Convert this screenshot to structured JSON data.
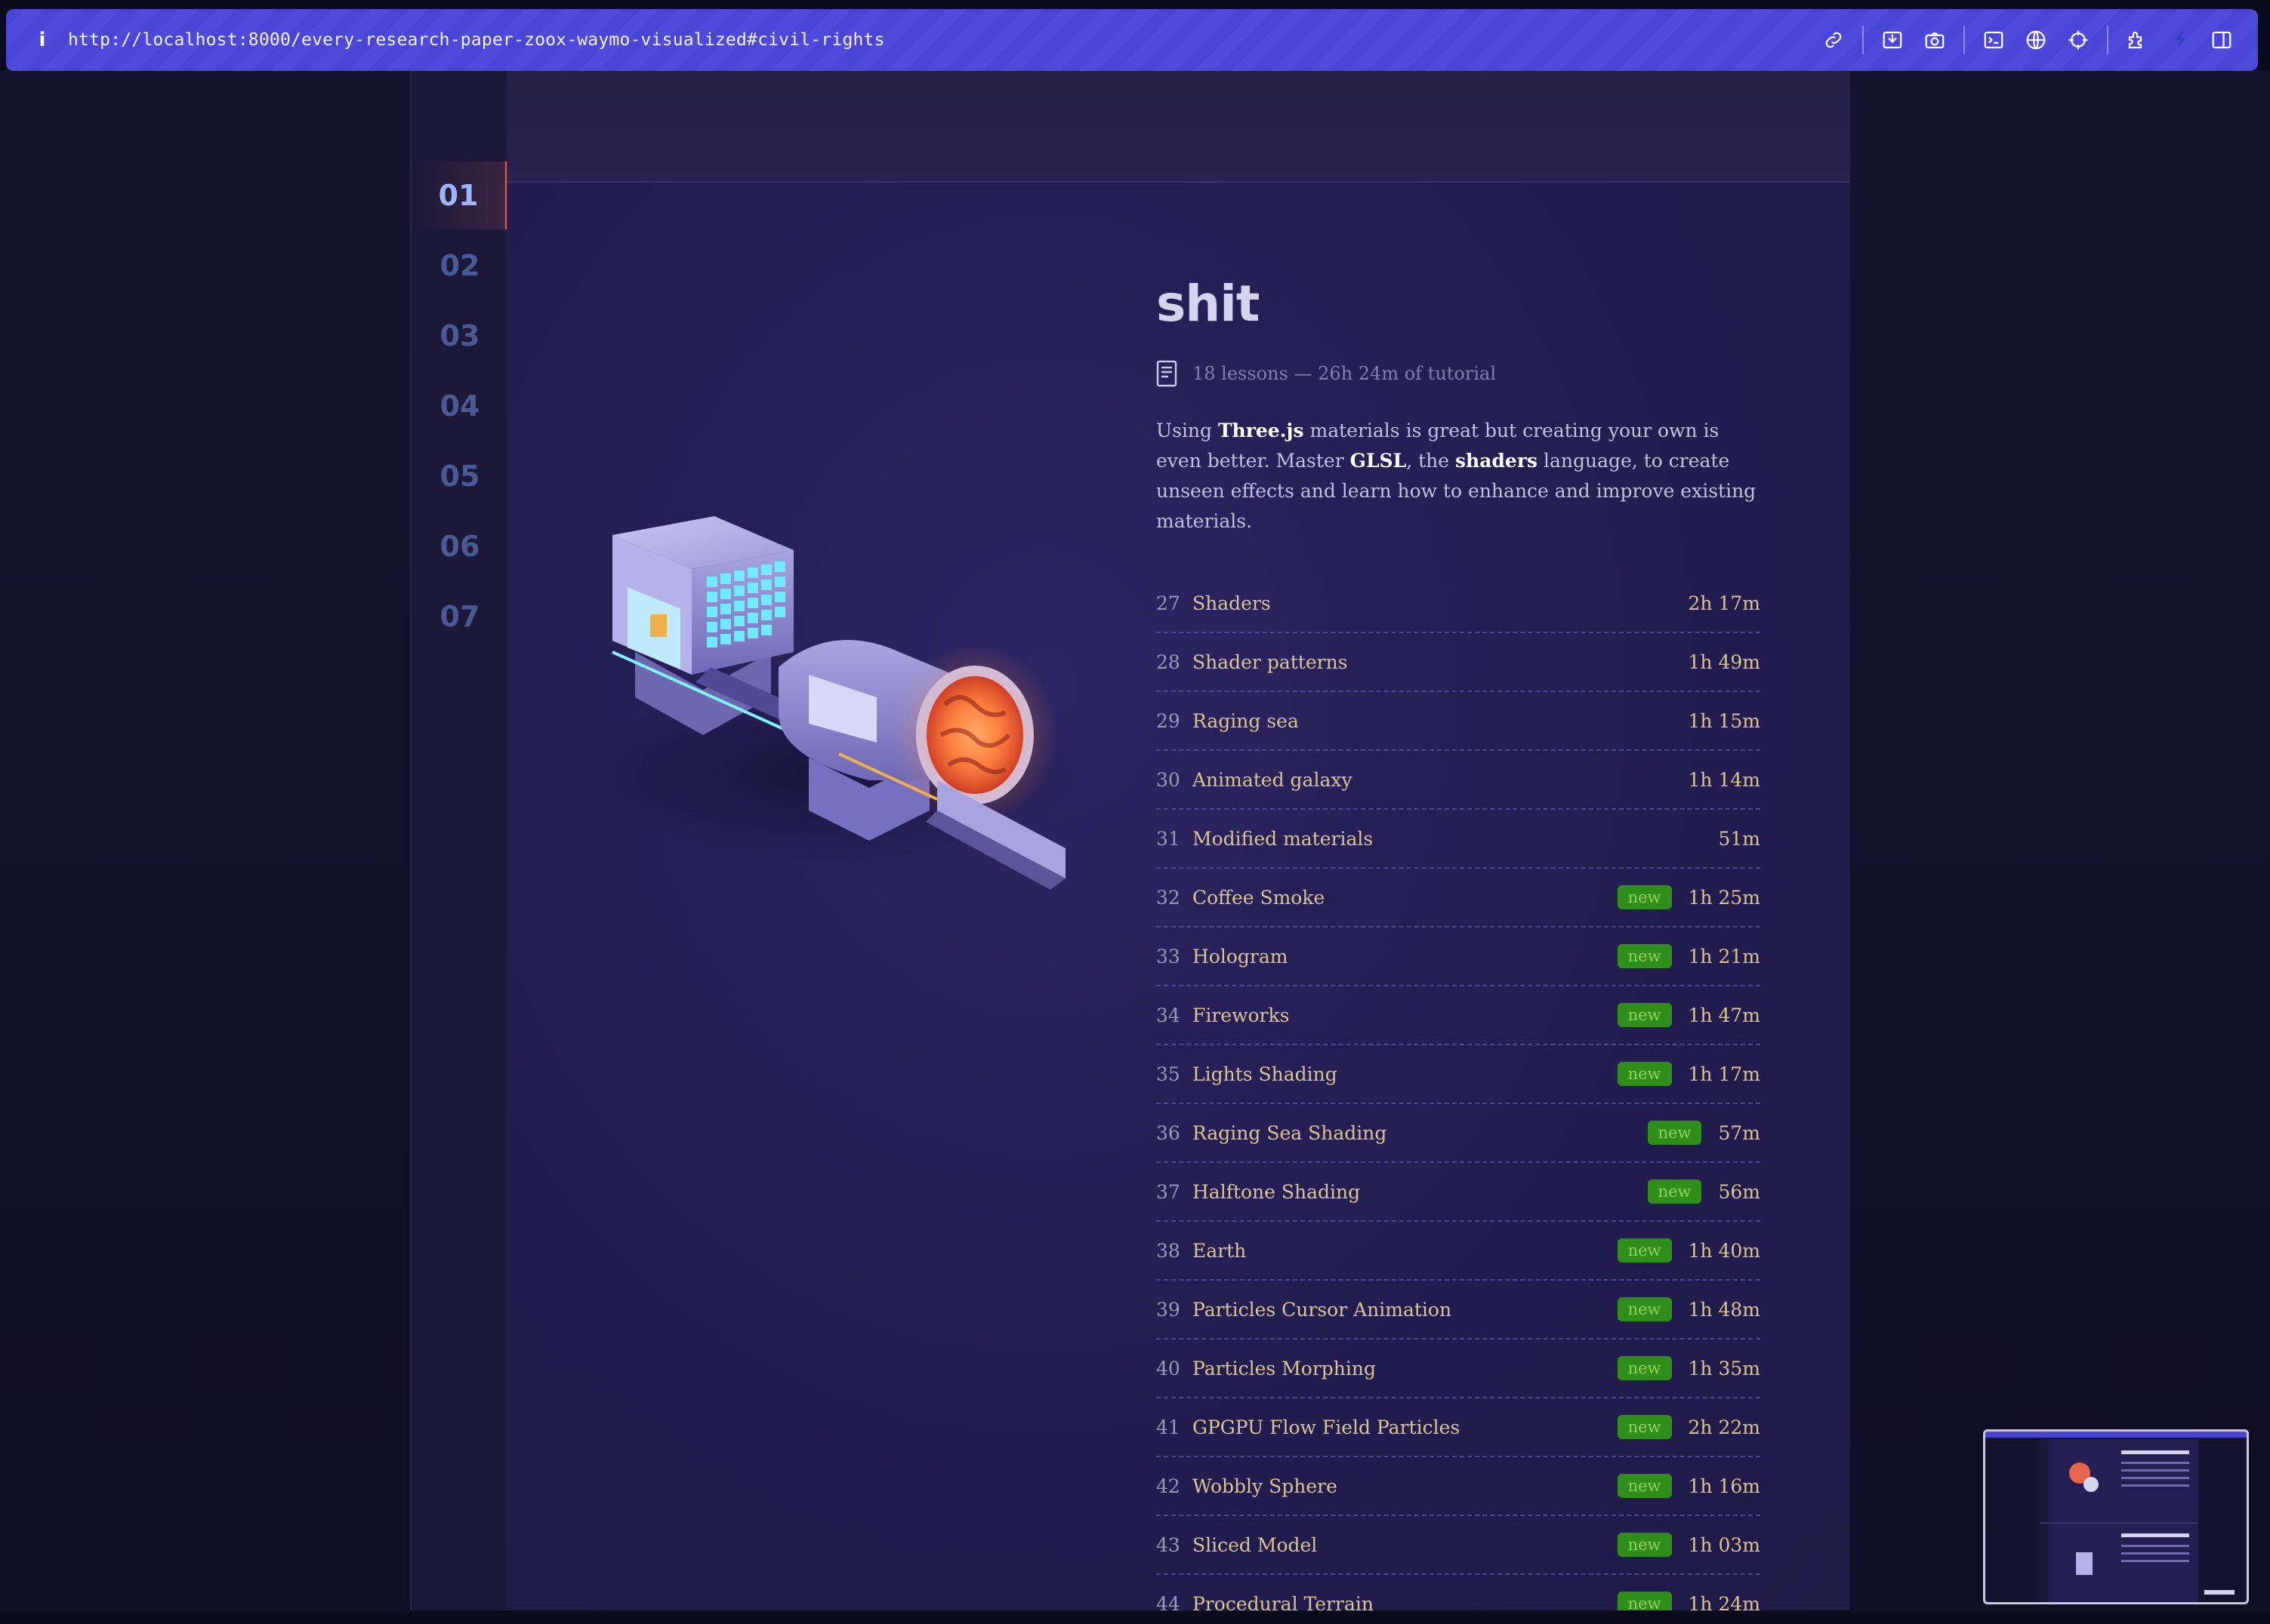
{
  "browser": {
    "url": "http://localhost:8000/every-research-paper-zoox-waymo-visualized#civil-rights",
    "info_label": "i"
  },
  "chapters": [
    {
      "label": "01",
      "active": true
    },
    {
      "label": "02",
      "active": false
    },
    {
      "label": "03",
      "active": false
    },
    {
      "label": "04",
      "active": false
    },
    {
      "label": "05",
      "active": false
    },
    {
      "label": "06",
      "active": false
    },
    {
      "label": "07",
      "active": false
    }
  ],
  "section": {
    "title": "shit",
    "meta": "18 lessons — 26h 24m of tutorial",
    "desc": {
      "p1": "Using ",
      "b1": "Three.js",
      "p2": " materials is great but creating your own is even better. Master ",
      "b2": "GLSL",
      "p3": ", the ",
      "b3": "shaders",
      "p4": " language, to create unseen effects and learn how to enhance and improve existing materials."
    }
  },
  "lessons": [
    {
      "num": "27",
      "name": "Shaders",
      "badge": "",
      "duration": "2h 17m"
    },
    {
      "num": "28",
      "name": "Shader patterns",
      "badge": "",
      "duration": "1h 49m"
    },
    {
      "num": "29",
      "name": "Raging sea",
      "badge": "",
      "duration": "1h 15m"
    },
    {
      "num": "30",
      "name": "Animated galaxy",
      "badge": "",
      "duration": "1h 14m"
    },
    {
      "num": "31",
      "name": "Modified materials",
      "badge": "",
      "duration": "51m"
    },
    {
      "num": "32",
      "name": "Coffee Smoke",
      "badge": "new",
      "duration": "1h 25m"
    },
    {
      "num": "33",
      "name": "Hologram",
      "badge": "new",
      "duration": "1h 21m"
    },
    {
      "num": "34",
      "name": "Fireworks",
      "badge": "new",
      "duration": "1h 47m"
    },
    {
      "num": "35",
      "name": "Lights Shading",
      "badge": "new",
      "duration": "1h 17m"
    },
    {
      "num": "36",
      "name": "Raging Sea Shading",
      "badge": "new",
      "duration": "57m"
    },
    {
      "num": "37",
      "name": "Halftone Shading",
      "badge": "new",
      "duration": "56m"
    },
    {
      "num": "38",
      "name": "Earth",
      "badge": "new",
      "duration": "1h 40m"
    },
    {
      "num": "39",
      "name": "Particles Cursor Animation",
      "badge": "new",
      "duration": "1h 48m"
    },
    {
      "num": "40",
      "name": "Particles Morphing",
      "badge": "new",
      "duration": "1h 35m"
    },
    {
      "num": "41",
      "name": "GPGPU Flow Field Particles",
      "badge": "new",
      "duration": "2h 22m"
    },
    {
      "num": "42",
      "name": "Wobbly Sphere",
      "badge": "new",
      "duration": "1h 16m"
    },
    {
      "num": "43",
      "name": "Sliced Model",
      "badge": "new",
      "duration": "1h 03m"
    },
    {
      "num": "44",
      "name": "Procedural Terrain",
      "badge": "new",
      "duration": "1h 24m"
    }
  ],
  "icons": {
    "toolbar": [
      "link-icon",
      "save-icon",
      "camera-icon",
      "terminal-icon",
      "globe-icon",
      "crosshair-icon",
      "extensions-icon",
      "profile-icon",
      "sidebar-icon"
    ]
  },
  "colors": {
    "toolbar": "#4a45d6",
    "accent": "#e8644a",
    "badge": "#2f8f1a",
    "lesson_text": "#d9c493"
  }
}
